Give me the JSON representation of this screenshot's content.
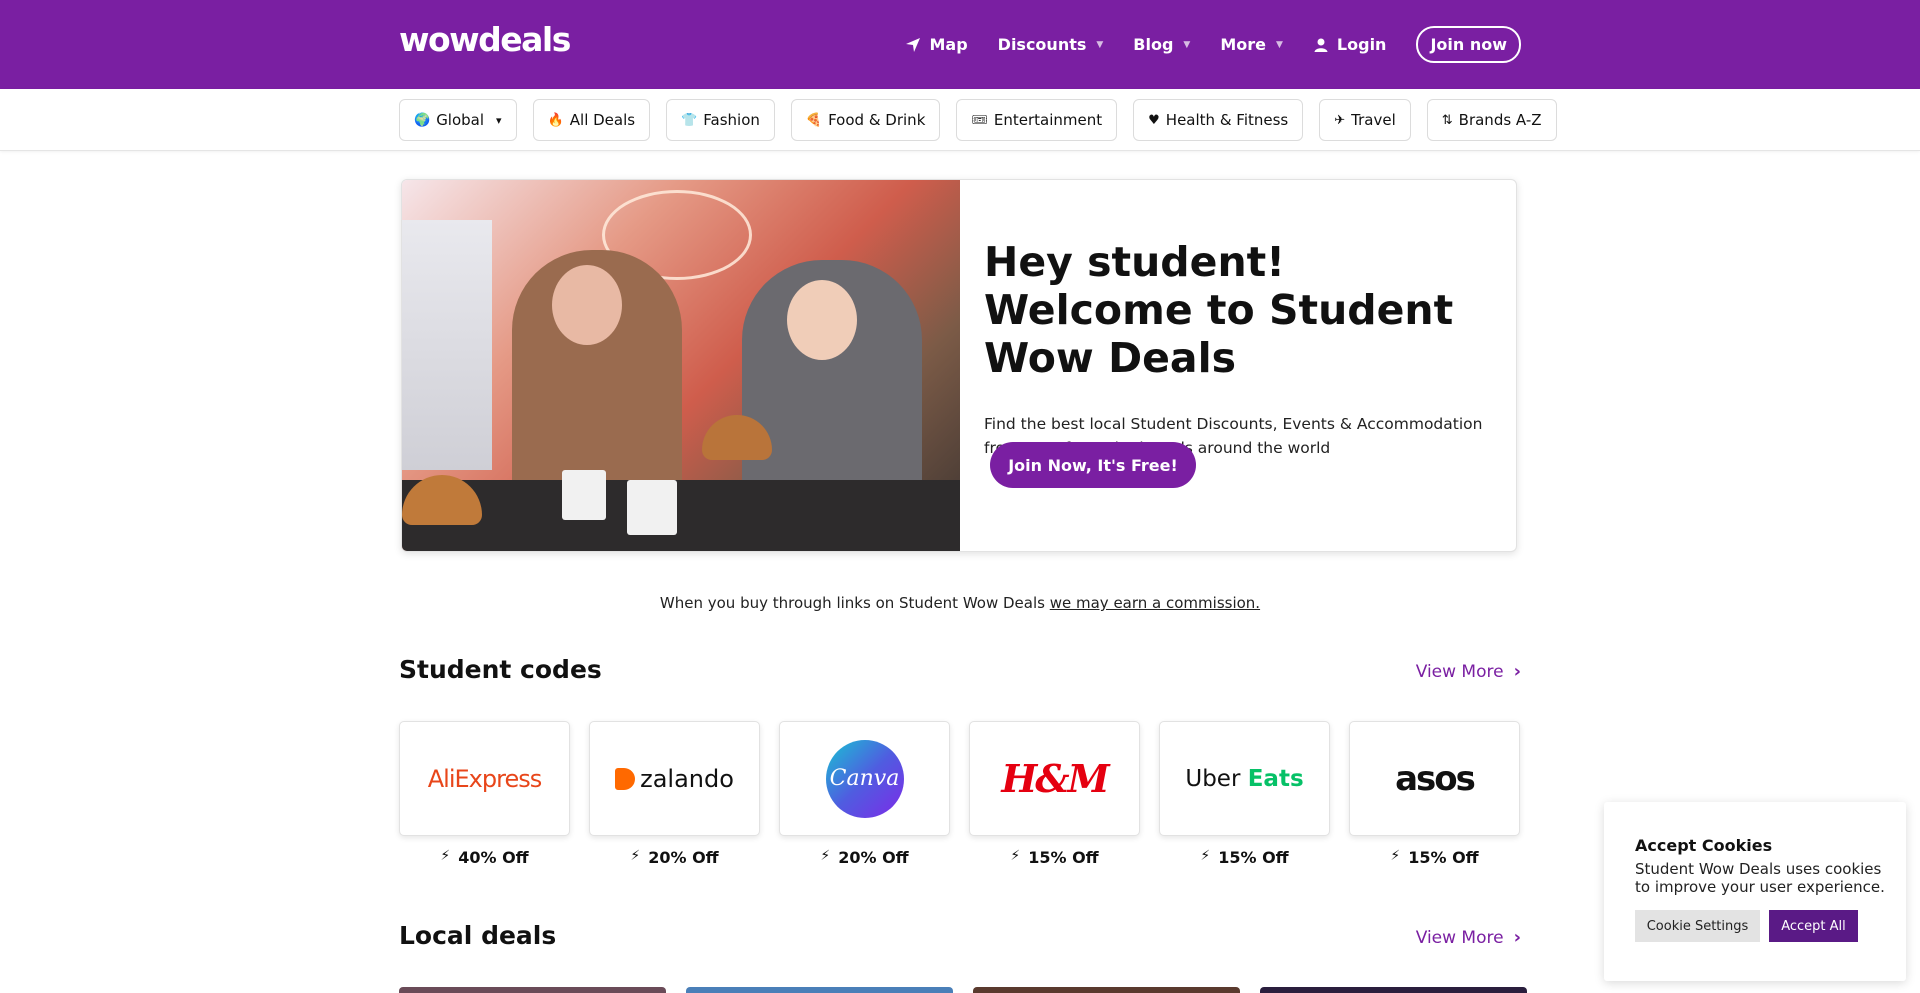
{
  "header": {
    "logo": "wowdeals",
    "nav": [
      {
        "label": "Map",
        "icon": "location-arrow-icon"
      },
      {
        "label": "Discounts",
        "dropdown": true
      },
      {
        "label": "Blog",
        "dropdown": true
      },
      {
        "label": "More",
        "dropdown": true
      },
      {
        "label": "Login",
        "icon": "user-icon"
      }
    ],
    "join_label": "Join now"
  },
  "categories": [
    {
      "label": "Global",
      "icon": "globe-icon",
      "dropdown": true
    },
    {
      "label": "All Deals",
      "icon": "fire-icon"
    },
    {
      "label": "Fashion",
      "icon": "shirt-icon"
    },
    {
      "label": "Food & Drink",
      "icon": "pizza-icon"
    },
    {
      "label": "Entertainment",
      "icon": "ticket-icon"
    },
    {
      "label": "Health & Fitness",
      "icon": "heart-pulse-icon"
    },
    {
      "label": "Travel",
      "icon": "plane-icon"
    },
    {
      "label": "Brands A-Z",
      "icon": "sort-alpha-icon"
    }
  ],
  "hero": {
    "title": "Hey student! Welcome to Student Wow Deals",
    "subtitle": "Find the best local Student Discounts, Events & Accommodation from your favourite brands around the world ",
    "cta": "Join Now, It's Free!"
  },
  "disclaimer": {
    "text": "When you buy through links on Student Wow Deals ",
    "link": "we may earn a commission."
  },
  "student_codes": {
    "title": "Student codes",
    "view_more": "View More",
    "items": [
      {
        "brand": "AliExpress",
        "discount": "40% Off"
      },
      {
        "brand": "zalando",
        "discount": "20% Off"
      },
      {
        "brand": "Canva",
        "discount": "20% Off"
      },
      {
        "brand": "H&M",
        "discount": "15% Off"
      },
      {
        "brand": "Uber Eats",
        "discount": "15% Off"
      },
      {
        "brand": "asos",
        "discount": "15% Off"
      }
    ]
  },
  "local_deals": {
    "title": "Local deals",
    "view_more": "View More"
  },
  "cookie": {
    "title": "Accept Cookies",
    "text": "Student Wow Deals uses cookies to improve your user experience.",
    "settings_label": "Cookie Settings",
    "accept_label": "Accept All"
  },
  "colors": {
    "brand_purple": "#7a1fa2",
    "accept_purple": "#5a1a86"
  }
}
